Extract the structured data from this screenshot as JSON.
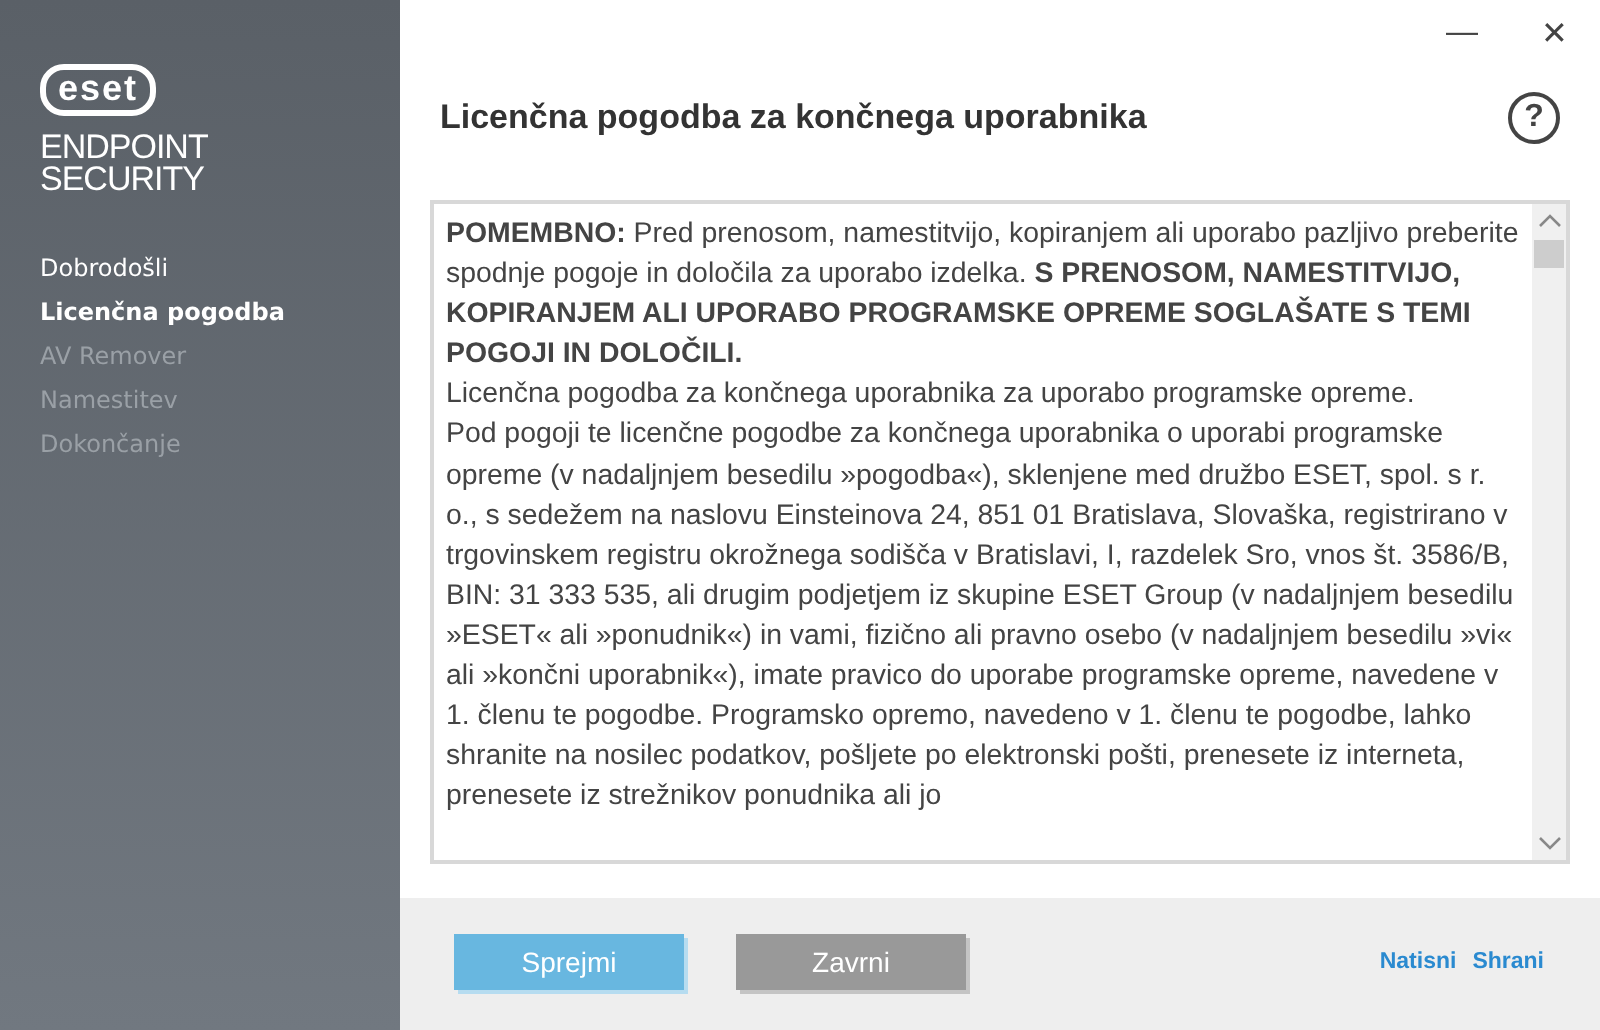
{
  "sidebar": {
    "logo": "eset",
    "product": [
      "ENDPOINT",
      "SECURITY"
    ],
    "items": [
      {
        "label": "Dobrodošli",
        "selected": false,
        "disabled": false
      },
      {
        "label": "Licenčna pogodba",
        "selected": true,
        "disabled": false
      },
      {
        "label": "AV Remover",
        "selected": false,
        "disabled": true
      },
      {
        "label": "Namestitev",
        "selected": false,
        "disabled": true
      },
      {
        "label": "Dokončanje",
        "selected": false,
        "disabled": true
      }
    ]
  },
  "window": {
    "minimize": "—",
    "close": "✕"
  },
  "header": {
    "title": "Licenčna pogodba za končnega uporabnika",
    "help": "?"
  },
  "license_text": [
    "**POMEMBNO:** Pred prenosom, namestitvijo, kopiranjem ali uporabo pazljivo preberite spodnje pogoje in določila za uporabo izdelka. **S PRENOSOM, NAMESTITVIJO, KOPIRANJEM ALI UPORABO PROGRAMSKE OPREME SOGLAŠATE S TEMI POGOJI IN DOLOČILI.**",
    "Licenčna pogodba za končnega uporabnika za uporabo programske opreme.",
    "Pod pogoji te licenčne pogodbe za končnega uporabnika o uporabi programske opreme (v nadaljnjem besedilu »pogodba«), sklenjene med družbo ESET, spol. s r. o., s sedežem na naslovu Einsteinova 24, 851 01 Bratislava, Slovaška, registrirano v trgovinskem registru okrožnega sodišča v Bratislavi, I, razdelek Sro, vnos št. 3586/B, BIN: 31 333 535, ali drugim podjetjem iz skupine ESET Group (v nadaljnjem besedilu »ESET« ali »ponudnik«) in vami, fizično ali pravno osebo (v nadaljnjem besedilu »vi« ali »končni uporabnik«), imate pravico do uporabe programske opreme, navedene v 1. členu te pogodbe. Programsko opremo, navedeno v 1. členu te pogodbe, lahko shranite na nosilec podatkov, pošljete po elektronski pošti, prenesete iz interneta, prenesete iz strežnikov ponudnika ali jo"
  ],
  "buttons": [
    {
      "label": "Sprejmi",
      "kind": "primary"
    },
    {
      "label": "Zavrni",
      "kind": "secondary"
    }
  ],
  "links": [
    "Natisni",
    "Shrani"
  ]
}
